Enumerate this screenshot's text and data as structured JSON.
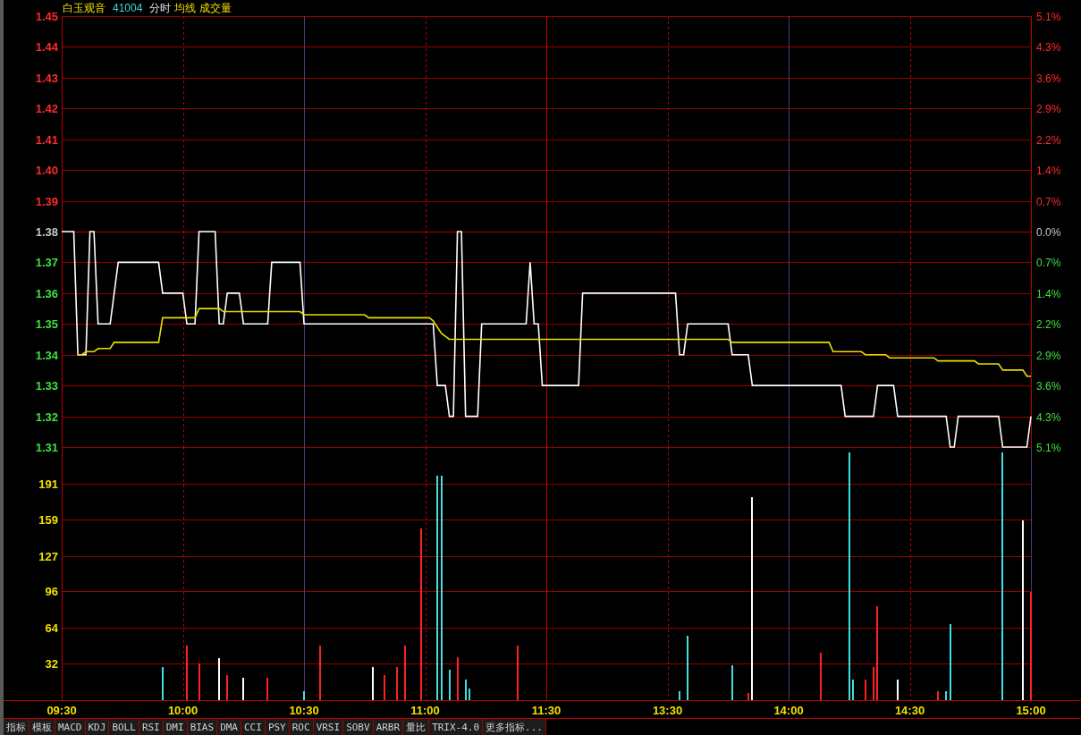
{
  "header": [
    {
      "kind": "name",
      "text": "白玉观音"
    },
    {
      "kind": "code",
      "text": "41004"
    },
    {
      "kind": "period",
      "text": "分时"
    },
    {
      "kind": "indicator",
      "text": "均线"
    },
    {
      "kind": "indicator",
      "text": "成交量"
    }
  ],
  "price_chart": {
    "chart_data": {
      "type": "line",
      "grid": true,
      "ref_lines": [
        {
          "axis": "y",
          "value": 1.38
        }
      ],
      "series": [
        {
          "color": "#ffffff",
          "values": [
            1.38,
            1.38,
            1.38,
            1.38,
            1.34,
            1.34,
            1.34,
            1.38,
            1.38,
            1.35,
            1.35,
            1.35,
            1.35,
            1.36,
            1.37,
            1.37,
            1.37,
            1.37,
            1.37,
            1.37,
            1.37,
            1.37,
            1.37,
            1.37,
            1.37,
            1.36,
            1.36,
            1.36,
            1.36,
            1.36,
            1.36,
            1.35,
            1.35,
            1.35,
            1.38,
            1.38,
            1.38,
            1.38,
            1.38,
            1.35,
            1.35,
            1.36,
            1.36,
            1.36,
            1.36,
            1.35,
            1.35,
            1.35,
            1.35,
            1.35,
            1.35,
            1.35,
            1.37,
            1.37,
            1.37,
            1.37,
            1.37,
            1.37,
            1.37,
            1.37,
            1.35,
            1.35,
            1.35,
            1.35,
            1.35,
            1.35,
            1.35,
            1.35,
            1.35,
            1.35,
            1.35,
            1.35,
            1.35,
            1.35,
            1.35,
            1.35,
            1.35,
            1.35,
            1.35,
            1.35,
            1.35,
            1.35,
            1.35,
            1.35,
            1.35,
            1.35,
            1.35,
            1.35,
            1.35,
            1.35,
            1.35,
            1.35,
            1.35,
            1.33,
            1.33,
            1.33,
            1.32,
            1.32,
            1.38,
            1.38,
            1.32,
            1.32,
            1.32,
            1.32,
            1.35,
            1.35,
            1.35,
            1.35,
            1.35,
            1.35,
            1.35,
            1.35,
            1.35,
            1.35,
            1.35,
            1.35,
            1.37,
            1.35,
            1.35,
            1.33,
            1.33,
            1.33,
            1.33,
            1.33,
            1.33,
            1.33,
            1.33,
            1.33,
            1.33,
            1.36,
            1.36,
            1.36,
            1.36,
            1.36,
            1.36,
            1.36,
            1.36,
            1.36,
            1.36,
            1.36,
            1.36,
            1.36,
            1.36,
            1.36,
            1.36,
            1.36,
            1.36,
            1.36,
            1.36,
            1.36,
            1.36,
            1.36,
            1.36,
            1.34,
            1.34,
            1.35,
            1.35,
            1.35,
            1.35,
            1.35,
            1.35,
            1.35,
            1.35,
            1.35,
            1.35,
            1.35,
            1.34,
            1.34,
            1.34,
            1.34,
            1.34,
            1.33,
            1.33,
            1.33,
            1.33,
            1.33,
            1.33,
            1.33,
            1.33,
            1.33,
            1.33,
            1.33,
            1.33,
            1.33,
            1.33,
            1.33,
            1.33,
            1.33,
            1.33,
            1.33,
            1.33,
            1.33,
            1.33,
            1.33,
            1.32,
            1.32,
            1.32,
            1.32,
            1.32,
            1.32,
            1.32,
            1.32,
            1.33,
            1.33,
            1.33,
            1.33,
            1.33,
            1.32,
            1.32,
            1.32,
            1.32,
            1.32,
            1.32,
            1.32,
            1.32,
            1.32,
            1.32,
            1.32,
            1.32,
            1.32,
            1.31,
            1.31,
            1.32,
            1.32,
            1.32,
            1.32,
            1.32,
            1.32,
            1.32,
            1.32,
            1.32,
            1.32,
            1.32,
            1.31,
            1.31,
            1.31,
            1.31,
            1.31,
            1.31,
            1.31,
            1.32
          ]
        },
        {
          "color": "#e8e000",
          "values": [
            null,
            null,
            null,
            null,
            1.34,
            1.34,
            1.341,
            1.341,
            1.341,
            1.342,
            1.342,
            1.342,
            1.342,
            1.344,
            1.344,
            1.344,
            1.344,
            1.344,
            1.344,
            1.344,
            1.344,
            1.344,
            1.344,
            1.344,
            1.344,
            1.352,
            1.352,
            1.352,
            1.352,
            1.352,
            1.352,
            1.352,
            1.352,
            1.352,
            1.355,
            1.355,
            1.355,
            1.355,
            1.355,
            1.355,
            1.354,
            1.354,
            1.354,
            1.354,
            1.354,
            1.354,
            1.354,
            1.354,
            1.354,
            1.354,
            1.354,
            1.354,
            1.354,
            1.354,
            1.354,
            1.354,
            1.354,
            1.354,
            1.354,
            1.354,
            1.353,
            1.353,
            1.353,
            1.353,
            1.353,
            1.353,
            1.353,
            1.353,
            1.353,
            1.353,
            1.353,
            1.353,
            1.353,
            1.353,
            1.353,
            1.353,
            1.352,
            1.352,
            1.352,
            1.352,
            1.352,
            1.352,
            1.352,
            1.352,
            1.352,
            1.352,
            1.352,
            1.352,
            1.352,
            1.352,
            1.352,
            1.352,
            1.351,
            1.349,
            1.347,
            1.346,
            1.345,
            1.345,
            1.345,
            1.345,
            1.345,
            1.345,
            1.345,
            1.345,
            1.345,
            1.345,
            1.345,
            1.345,
            1.345,
            1.345,
            1.345,
            1.345,
            1.345,
            1.345,
            1.345,
            1.345,
            1.345,
            1.345,
            1.345,
            1.345,
            1.345,
            1.345,
            1.345,
            1.345,
            1.345,
            1.345,
            1.345,
            1.345,
            1.345,
            1.345,
            1.345,
            1.345,
            1.345,
            1.345,
            1.345,
            1.345,
            1.345,
            1.345,
            1.345,
            1.345,
            1.345,
            1.345,
            1.345,
            1.345,
            1.345,
            1.345,
            1.345,
            1.345,
            1.345,
            1.345,
            1.345,
            1.345,
            1.345,
            1.345,
            1.345,
            1.345,
            1.345,
            1.345,
            1.345,
            1.345,
            1.345,
            1.345,
            1.345,
            1.345,
            1.345,
            1.345,
            1.344,
            1.344,
            1.344,
            1.344,
            1.344,
            1.344,
            1.344,
            1.344,
            1.344,
            1.344,
            1.344,
            1.344,
            1.344,
            1.344,
            1.344,
            1.344,
            1.344,
            1.344,
            1.344,
            1.344,
            1.344,
            1.344,
            1.344,
            1.344,
            1.344,
            1.341,
            1.341,
            1.341,
            1.341,
            1.341,
            1.341,
            1.341,
            1.341,
            1.34,
            1.34,
            1.34,
            1.34,
            1.34,
            1.34,
            1.339,
            1.339,
            1.339,
            1.339,
            1.339,
            1.339,
            1.339,
            1.339,
            1.339,
            1.339,
            1.339,
            1.339,
            1.338,
            1.338,
            1.338,
            1.338,
            1.338,
            1.338,
            1.338,
            1.338,
            1.338,
            1.338,
            1.337,
            1.337,
            1.337,
            1.337,
            1.337,
            1.337,
            1.335,
            1.335,
            1.335,
            1.335,
            1.335,
            1.335,
            1.333,
            1.333
          ]
        }
      ],
      "ylim": [
        1.31,
        1.45
      ],
      "y2lim": [
        -5.072,
        5.072
      ],
      "yticks": [
        {
          "value": 1.45,
          "label": "1.45"
        },
        {
          "value": 1.44,
          "label": "1.44"
        },
        {
          "value": 1.43,
          "label": "1.43"
        },
        {
          "value": 1.42,
          "label": "1.42"
        },
        {
          "value": 1.41,
          "label": "1.41"
        },
        {
          "value": 1.4,
          "label": "1.40"
        },
        {
          "value": 1.39,
          "label": "1.39"
        },
        {
          "value": 1.38,
          "label": "1.38"
        },
        {
          "value": 1.37,
          "label": "1.37"
        },
        {
          "value": 1.36,
          "label": "1.36"
        },
        {
          "value": 1.35,
          "label": "1.35"
        },
        {
          "value": 1.34,
          "label": "1.34"
        },
        {
          "value": 1.33,
          "label": "1.33"
        },
        {
          "value": 1.32,
          "label": "1.32"
        },
        {
          "value": 1.31,
          "label": "1.31"
        }
      ],
      "y2ticks": [
        {
          "value": 5.072,
          "label": "5.1%"
        },
        {
          "value": 4.348,
          "label": "4.3%"
        },
        {
          "value": 3.623,
          "label": "3.6%"
        },
        {
          "value": 2.899,
          "label": "2.9%"
        },
        {
          "value": 2.174,
          "label": "2.2%"
        },
        {
          "value": 1.449,
          "label": "1.4%"
        },
        {
          "value": 0.725,
          "label": "0.7%"
        },
        {
          "value": 0,
          "label": "0.0%"
        },
        {
          "value": -0.725,
          "label": "0.7%"
        },
        {
          "value": -1.449,
          "label": "1.4%"
        },
        {
          "value": -2.174,
          "label": "2.2%"
        },
        {
          "value": -2.899,
          "label": "2.9%"
        },
        {
          "value": -3.623,
          "label": "3.6%"
        },
        {
          "value": -4.348,
          "label": "4.3%"
        },
        {
          "value": -5.072,
          "label": "5.1%"
        }
      ]
    }
  },
  "volume_chart": {
    "chart_data": {
      "type": "bar",
      "stacked": true,
      "grid": true,
      "categories": [
        "09:30",
        null,
        null,
        null,
        null,
        null,
        null,
        null,
        null,
        null,
        null,
        null,
        null,
        null,
        null,
        null,
        null,
        null,
        null,
        null,
        null,
        null,
        null,
        null,
        null,
        null,
        null,
        null,
        null,
        null,
        "10:00",
        null,
        null,
        null,
        null,
        null,
        null,
        null,
        null,
        null,
        null,
        null,
        null,
        null,
        null,
        null,
        null,
        null,
        null,
        null,
        null,
        null,
        null,
        null,
        null,
        null,
        null,
        null,
        null,
        null,
        "10:30",
        null,
        null,
        null,
        null,
        null,
        null,
        null,
        null,
        null,
        null,
        null,
        null,
        null,
        null,
        null,
        null,
        null,
        null,
        null,
        null,
        null,
        null,
        null,
        null,
        null,
        null,
        null,
        null,
        null,
        "11:00",
        null,
        null,
        null,
        null,
        null,
        null,
        null,
        null,
        null,
        null,
        null,
        null,
        null,
        null,
        null,
        null,
        null,
        null,
        null,
        null,
        null,
        null,
        null,
        null,
        null,
        null,
        null,
        null,
        null,
        "11:30",
        null,
        null,
        null,
        null,
        null,
        null,
        null,
        null,
        null,
        null,
        null,
        null,
        null,
        null,
        null,
        null,
        null,
        null,
        null,
        null,
        null,
        null,
        null,
        null,
        null,
        null,
        null,
        null,
        null,
        "13:30",
        null,
        null,
        null,
        null,
        null,
        null,
        null,
        null,
        null,
        null,
        null,
        null,
        null,
        null,
        null,
        null,
        null,
        null,
        null,
        null,
        null,
        null,
        null,
        null,
        null,
        null,
        null,
        null,
        null,
        "14:00",
        null,
        null,
        null,
        null,
        null,
        null,
        null,
        null,
        null,
        null,
        null,
        null,
        null,
        null,
        null,
        null,
        null,
        null,
        null,
        null,
        null,
        null,
        null,
        null,
        null,
        null,
        null,
        null,
        null,
        "14:30",
        null,
        null,
        null,
        null,
        null,
        null,
        null,
        null,
        null,
        null,
        null,
        null,
        null,
        null,
        null,
        null,
        null,
        null,
        null,
        null,
        null,
        null,
        null,
        null,
        null,
        null,
        null,
        null,
        null,
        "15:00"
      ],
      "series": [
        {
          "color": "#ff2020",
          "values": [
            null,
            null,
            null,
            null,
            null,
            null,
            null,
            null,
            null,
            null,
            null,
            null,
            null,
            null,
            null,
            null,
            null,
            null,
            null,
            null,
            null,
            null,
            null,
            null,
            null,
            null,
            null,
            null,
            null,
            null,
            null,
            48,
            null,
            null,
            32,
            null,
            null,
            null,
            null,
            null,
            null,
            22,
            null,
            null,
            null,
            null,
            null,
            null,
            null,
            null,
            null,
            20,
            null,
            null,
            null,
            null,
            null,
            null,
            null,
            null,
            null,
            null,
            null,
            null,
            48,
            null,
            null,
            null,
            null,
            null,
            null,
            null,
            null,
            null,
            null,
            null,
            null,
            null,
            null,
            null,
            22,
            null,
            null,
            29,
            null,
            48,
            null,
            null,
            null,
            151,
            null,
            null,
            null,
            null,
            null,
            null,
            null,
            null,
            38,
            null,
            null,
            null,
            null,
            null,
            null,
            null,
            null,
            null,
            null,
            null,
            null,
            null,
            null,
            48,
            null,
            null,
            null,
            null,
            null,
            null,
            null,
            null,
            null,
            null,
            null,
            null,
            null,
            null,
            null,
            null,
            null,
            null,
            null,
            null,
            null,
            null,
            null,
            null,
            null,
            null,
            null,
            null,
            null,
            null,
            null,
            null,
            null,
            null,
            null,
            null,
            null,
            null,
            null,
            null,
            null,
            null,
            null,
            null,
            null,
            null,
            null,
            null,
            null,
            null,
            null,
            null,
            null,
            null,
            null,
            null,
            6,
            null,
            null,
            null,
            null,
            null,
            null,
            null,
            null,
            null,
            null,
            null,
            null,
            null,
            null,
            null,
            null,
            null,
            42,
            null,
            null,
            null,
            null,
            null,
            null,
            null,
            null,
            null,
            null,
            18,
            null,
            29,
            83,
            null,
            null,
            null,
            null,
            null,
            null,
            null,
            null,
            null,
            null,
            null,
            null,
            null,
            null,
            8,
            null,
            null,
            null,
            null,
            null,
            null,
            null,
            null,
            null,
            null,
            null,
            null,
            null,
            null,
            null,
            null,
            null,
            null,
            null,
            null,
            null,
            null,
            95
          ]
        },
        {
          "color": "#40e0e0",
          "values": [
            null,
            null,
            null,
            null,
            null,
            null,
            null,
            null,
            null,
            null,
            null,
            null,
            null,
            null,
            null,
            null,
            null,
            null,
            null,
            null,
            null,
            null,
            null,
            null,
            null,
            29,
            null,
            null,
            null,
            null,
            null,
            null,
            null,
            null,
            null,
            null,
            null,
            null,
            null,
            null,
            null,
            null,
            null,
            null,
            null,
            null,
            null,
            null,
            null,
            null,
            null,
            null,
            null,
            null,
            null,
            null,
            null,
            null,
            null,
            null,
            8,
            null,
            null,
            null,
            null,
            null,
            null,
            null,
            null,
            null,
            null,
            null,
            null,
            null,
            null,
            null,
            null,
            null,
            null,
            null,
            null,
            null,
            null,
            null,
            null,
            null,
            null,
            null,
            null,
            null,
            null,
            null,
            null,
            198,
            198,
            null,
            27,
            null,
            null,
            null,
            18,
            10,
            null,
            null,
            null,
            null,
            null,
            null,
            null,
            null,
            null,
            null,
            null,
            null,
            null,
            null,
            null,
            null,
            null,
            null,
            null,
            null,
            null,
            null,
            null,
            null,
            null,
            null,
            null,
            null,
            null,
            null,
            null,
            null,
            null,
            null,
            null,
            null,
            null,
            null,
            null,
            null,
            null,
            null,
            null,
            null,
            null,
            null,
            null,
            null,
            null,
            null,
            null,
            8,
            null,
            57,
            null,
            null,
            null,
            null,
            null,
            null,
            null,
            null,
            null,
            null,
            31,
            null,
            null,
            null,
            null,
            null,
            null,
            null,
            null,
            null,
            null,
            null,
            null,
            null,
            null,
            null,
            null,
            null,
            null,
            null,
            null,
            null,
            null,
            null,
            null,
            null,
            null,
            null,
            null,
            218,
            18,
            null,
            null,
            null,
            null,
            null,
            null,
            null,
            null,
            null,
            null,
            null,
            null,
            null,
            null,
            null,
            null,
            null,
            null,
            null,
            null,
            null,
            null,
            8,
            67,
            null,
            null,
            null,
            null,
            null,
            null,
            null,
            null,
            null,
            null,
            null,
            null,
            218,
            null,
            null,
            null,
            null,
            null,
            null,
            null
          ]
        },
        {
          "color": "#ffffff",
          "values": [
            null,
            null,
            null,
            null,
            null,
            null,
            null,
            null,
            null,
            null,
            null,
            null,
            null,
            null,
            null,
            null,
            null,
            null,
            null,
            null,
            null,
            null,
            null,
            null,
            null,
            null,
            null,
            null,
            null,
            null,
            null,
            null,
            null,
            null,
            null,
            null,
            null,
            null,
            null,
            37,
            null,
            null,
            null,
            null,
            null,
            20,
            null,
            null,
            null,
            null,
            null,
            null,
            null,
            null,
            null,
            null,
            null,
            null,
            null,
            null,
            null,
            null,
            null,
            null,
            null,
            null,
            null,
            null,
            null,
            null,
            null,
            null,
            null,
            null,
            null,
            null,
            null,
            29,
            null,
            null,
            null,
            null,
            null,
            null,
            null,
            null,
            null,
            null,
            null,
            null,
            null,
            null,
            null,
            null,
            null,
            null,
            null,
            null,
            null,
            null,
            null,
            null,
            null,
            null,
            null,
            null,
            null,
            null,
            null,
            null,
            null,
            null,
            null,
            null,
            null,
            null,
            null,
            null,
            null,
            null,
            null,
            null,
            null,
            null,
            null,
            null,
            null,
            null,
            null,
            null,
            null,
            null,
            null,
            null,
            null,
            null,
            null,
            null,
            null,
            null,
            null,
            null,
            null,
            null,
            null,
            null,
            null,
            null,
            null,
            null,
            null,
            null,
            null,
            null,
            null,
            null,
            null,
            null,
            null,
            null,
            null,
            null,
            null,
            null,
            null,
            null,
            null,
            null,
            null,
            null,
            null,
            179,
            null,
            null,
            null,
            null,
            null,
            null,
            null,
            null,
            null,
            null,
            null,
            null,
            null,
            null,
            null,
            null,
            null,
            null,
            null,
            null,
            null,
            null,
            null,
            null,
            null,
            null,
            null,
            null,
            null,
            null,
            null,
            null,
            null,
            null,
            null,
            18,
            null,
            null,
            null,
            null,
            null,
            null,
            null,
            null,
            null,
            null,
            null,
            null,
            null,
            null,
            null,
            null,
            null,
            null,
            null,
            null,
            null,
            null,
            null,
            null,
            null,
            null,
            null,
            null,
            null,
            null,
            158,
            null,
            null
          ]
        }
      ],
      "ylim": [
        0,
        223
      ],
      "yticks": [
        {
          "value": 191,
          "label": "191"
        },
        {
          "value": 159,
          "label": "159"
        },
        {
          "value": 127,
          "label": "127"
        },
        {
          "value": 96,
          "label": "96"
        },
        {
          "value": 64,
          "label": "64"
        },
        {
          "value": 32,
          "label": "32"
        }
      ]
    }
  },
  "tabs": [
    {
      "label": "指标",
      "selected": false
    },
    {
      "label": "模板",
      "selected": false
    },
    {
      "label": "MACD",
      "selected": false
    },
    {
      "label": "KDJ",
      "selected": false
    },
    {
      "label": "BOLL",
      "selected": false
    },
    {
      "label": "RSI",
      "selected": false
    },
    {
      "label": "DMI",
      "selected": false
    },
    {
      "label": "BIAS",
      "selected": false
    },
    {
      "label": "DMA",
      "selected": false
    },
    {
      "label": "CCI",
      "selected": false
    },
    {
      "label": "PSY",
      "selected": false
    },
    {
      "label": "ROC",
      "selected": false
    },
    {
      "label": "VRSI",
      "selected": false
    },
    {
      "label": "SOBV",
      "selected": false
    },
    {
      "label": "ARBR",
      "selected": false
    },
    {
      "label": "量比",
      "selected": false
    },
    {
      "label": "TRIX-4.0",
      "selected": false
    },
    {
      "label": "更多指标...",
      "selected": false
    }
  ]
}
